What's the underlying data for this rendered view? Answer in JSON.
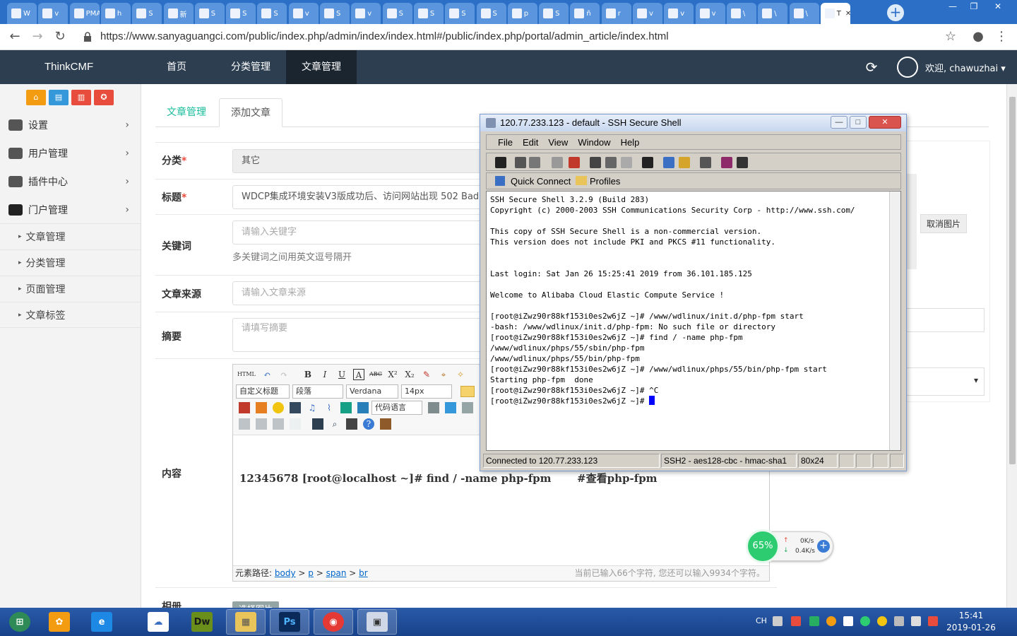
{
  "browser": {
    "tabs": [
      {
        "label": "W"
      },
      {
        "label": "v"
      },
      {
        "label": "PMA"
      },
      {
        "label": "h"
      },
      {
        "label": "S"
      },
      {
        "label": "新"
      },
      {
        "label": "S"
      },
      {
        "label": "S"
      },
      {
        "label": "S"
      },
      {
        "label": "v"
      },
      {
        "label": "S"
      },
      {
        "label": "v"
      },
      {
        "label": "S"
      },
      {
        "label": "S"
      },
      {
        "label": "S"
      },
      {
        "label": "S"
      },
      {
        "label": "p"
      },
      {
        "label": "S"
      },
      {
        "label": "ñ"
      },
      {
        "label": "r"
      },
      {
        "label": "v"
      },
      {
        "label": "v"
      },
      {
        "label": "v"
      },
      {
        "label": "\\"
      },
      {
        "label": "\\"
      },
      {
        "label": "\\"
      },
      {
        "label": "T"
      }
    ],
    "active_tab_close": "✕",
    "new_tab": "+",
    "window_controls": [
      "—",
      "❐",
      "✕"
    ],
    "url": "https://www.sanyaguangci.com/public/index.php/admin/index/index.html#/public/index.php/portal/admin_article/index.html",
    "back": "←",
    "forward": "→",
    "reload": "↻",
    "star": "☆",
    "profile": "●",
    "more": "⋮"
  },
  "header": {
    "brand": "ThinkCMF",
    "nav": [
      "首页",
      "分类管理",
      "文章管理"
    ],
    "refresh_icon": "⟳",
    "user": "欢迎, chawuzhai ▾"
  },
  "sidebar": {
    "quick": [
      "⌂",
      "▤",
      "▥",
      "✪"
    ],
    "items": [
      {
        "label": "设置",
        "chev": "›"
      },
      {
        "label": "用户管理",
        "chev": "›"
      },
      {
        "label": "插件中心",
        "chev": "›"
      },
      {
        "label": "门户管理",
        "chev": "›"
      }
    ],
    "subitems": [
      "文章管理",
      "分类管理",
      "页面管理",
      "文章标签"
    ],
    "caret": "▸"
  },
  "main": {
    "tabs": [
      "文章管理",
      "添加文章"
    ],
    "fields": {
      "category_label": "分类",
      "category_value": "其它",
      "title_label": "标题",
      "title_value": "WDCP集成环境安装V3版成功后、访问网站出现 502 Bad",
      "keywords_label": "关键词",
      "keywords_placeholder": "请输入关键字",
      "keywords_hint": "多关键词之间用英文逗号隔开",
      "source_label": "文章来源",
      "source_placeholder": "请输入文章来源",
      "summary_label": "摘要",
      "summary_placeholder": "请填写摘要",
      "content_label": "内容",
      "album_label": "相册",
      "album_button": "选择图片",
      "required_mark": "*"
    },
    "editor": {
      "toolbar_row1": [
        "HTML",
        "↶",
        "↷",
        "B",
        "I",
        "U",
        "A",
        "ABC",
        "X²",
        "X₂",
        "✎",
        "⌖",
        "✧"
      ],
      "selects": [
        "自定义标题",
        "段落",
        "Verdana",
        "14px"
      ],
      "code_lang": "代码语言",
      "content": "12345678 [root@localhost ~]# find / -name php-fpm       #查看php-fpm",
      "path_label": "元素路径:",
      "path": [
        "body",
        "p",
        "span",
        "br"
      ],
      "path_sep": ">",
      "count": "当前已输入66个字符, 您还可以输入9934个字符。"
    },
    "thumb_cancel": "取消图片",
    "select_arrow": "▾"
  },
  "ssh": {
    "title": "120.77.233.123 - default - SSH Secure Shell",
    "window_buttons": [
      "—",
      "□",
      "✕"
    ],
    "menu": [
      "File",
      "Edit",
      "View",
      "Window",
      "Help"
    ],
    "quick_connect": "Quick Connect",
    "profiles": "Profiles",
    "terminal_lines": [
      "SSH Secure Shell 3.2.9 (Build 283)",
      "Copyright (c) 2000-2003 SSH Communications Security Corp - http://www.ssh.com/",
      "",
      "This copy of SSH Secure Shell is a non-commercial version.",
      "This version does not include PKI and PKCS #11 functionality.",
      "",
      "",
      "Last login: Sat Jan 26 15:25:41 2019 from 36.101.185.125",
      "",
      "Welcome to Alibaba Cloud Elastic Compute Service !",
      "",
      "[root@iZwz90r88kf153i0es2w6jZ ~]# /www/wdlinux/init.d/php-fpm start",
      "-bash: /www/wdlinux/init.d/php-fpm: No such file or directory",
      "[root@iZwz90r88kf153i0es2w6jZ ~]# find / -name php-fpm",
      "/www/wdlinux/phps/55/sbin/php-fpm",
      "/www/wdlinux/phps/55/bin/php-fpm",
      "[root@iZwz90r88kf153i0es2w6jZ ~]# /www/wdlinux/phps/55/bin/php-fpm start",
      "Starting php-fpm  done",
      "[root@iZwz90r88kf153i0es2w6jZ ~]# ^C"
    ],
    "prompt": "[root@iZwz90r88kf153i0es2w6jZ ~]# ",
    "status_connected": "Connected to 120.77.233.123",
    "status_cipher": "SSH2 - aes128-cbc - hmac-sha1",
    "status_size": "80x24"
  },
  "netwidget": {
    "percent": "65%",
    "up": "0K/s",
    "down": "0.4K/s",
    "plus": "+"
  },
  "taskbar": {
    "apps": [
      "⊞",
      "✿",
      "e",
      "☁",
      "Dw",
      "▦",
      "Ps",
      "◉",
      "▣"
    ],
    "lang": "CH",
    "time": "15:41",
    "date": "2019-01-26"
  },
  "colors": {
    "header_bg": "#2c3e50",
    "accent_green": "#18bc9c",
    "required_red": "#e74c3c",
    "tab_strip": "#2b6fc7",
    "taskbar": "#1d4a95"
  }
}
